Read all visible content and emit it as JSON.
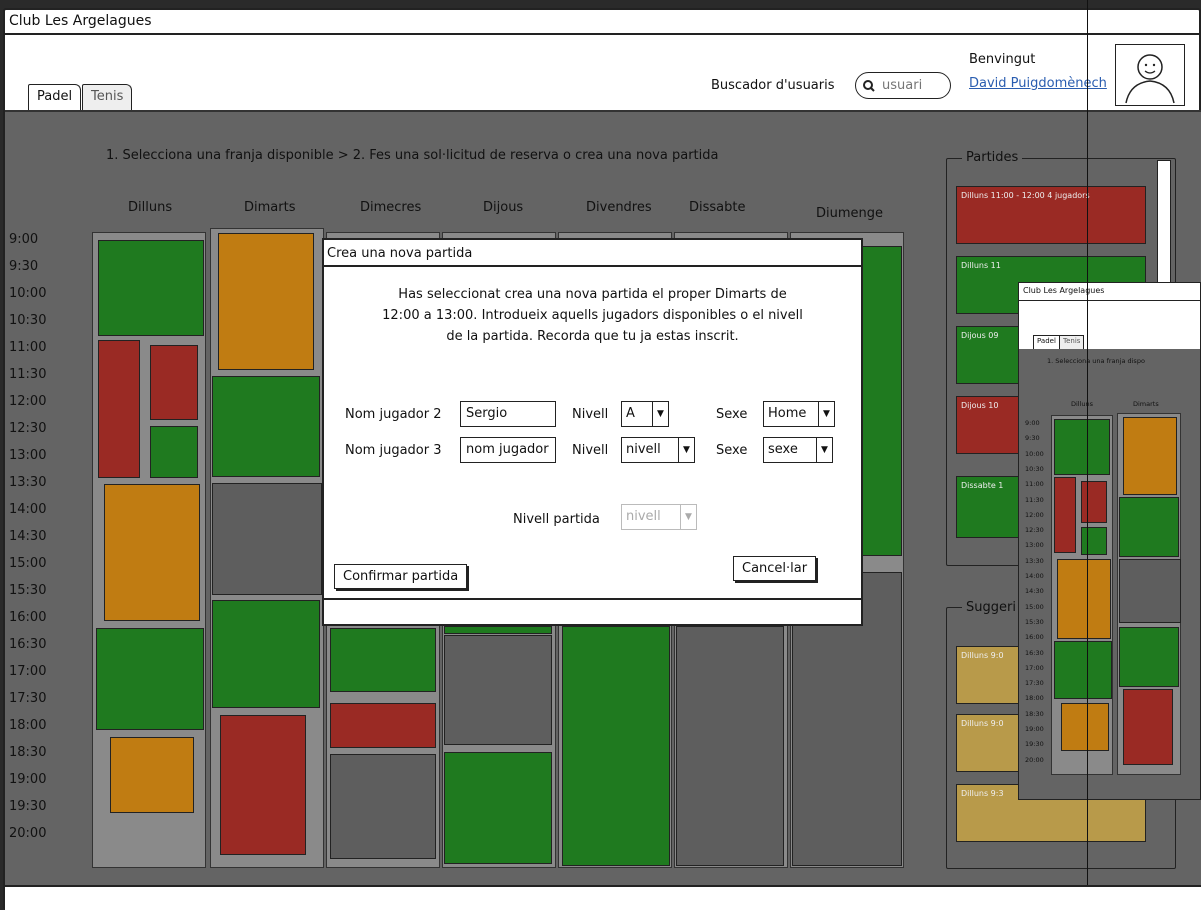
{
  "app": {
    "title": "Club Les Argelagues"
  },
  "tabs": [
    {
      "label": "Padel",
      "active": true
    },
    {
      "label": "Tenis",
      "active": false
    }
  ],
  "search": {
    "label": "Buscador d'usuaris",
    "placeholder": "usuari"
  },
  "user": {
    "welcome": "Benvingut",
    "name": "David Puigdomènech"
  },
  "steps": "1. Selecciona una franja disponible > 2. Fes una sol·licitud de reserva o crea una nova partida",
  "days": [
    "Dilluns",
    "Dimarts",
    "Dimecres",
    "Dijous",
    "Divendres",
    "Dissabte",
    "Diumenge"
  ],
  "times": [
    "9:00",
    "9:30",
    "10:00",
    "10:30",
    "11:00",
    "11:30",
    "12:00",
    "12:30",
    "13:00",
    "13:30",
    "14:00",
    "14:30",
    "15:00",
    "15:30",
    "16:00",
    "16:30",
    "17:00",
    "17:30",
    "18:00",
    "18:30",
    "19:00",
    "19:30",
    "20:00"
  ],
  "colors": {
    "available": "#1f7a1f",
    "partial": "#c07c12",
    "full": "#9a2a24",
    "closed": "#5e5e5e",
    "suggestion": "#b89a4a"
  },
  "partides": {
    "legend": "Partides",
    "items": [
      {
        "text": "Dilluns 11:00 - 12:00 4 jugadors",
        "status": "full"
      },
      {
        "text": "Dilluns 11",
        "status": "available"
      },
      {
        "text": "Dijous 09",
        "status": "available"
      },
      {
        "text": "Dijous 10",
        "status": "full"
      },
      {
        "text": "Dissabte 1",
        "status": "available"
      }
    ]
  },
  "suggeriments": {
    "legend": "Suggeri",
    "items": [
      {
        "text": "Dilluns 9:0"
      },
      {
        "text": "Dilluns 9:0"
      },
      {
        "text": "Dilluns 9:3"
      }
    ]
  },
  "dialog": {
    "title": "Crea una nova partida",
    "message": "Has seleccionat crea una nova partida el proper Dimarts de 12:00 a 13:00. Introdueix aquells jugadors disponibles o el nivell de la partida. Recorda que tu ja estas inscrit.",
    "row1": {
      "name_label": "Nom jugador 2",
      "name_value": "Sergio",
      "level_label": "Nivell",
      "level_value": "A",
      "sex_label": "Sexe",
      "sex_value": "Home"
    },
    "row2": {
      "name_label": "Nom jugador 3",
      "name_value": "nom jugador",
      "level_label": "Nivell",
      "level_value": "nivell",
      "sex_label": "Sexe",
      "sex_value": "sexe"
    },
    "match_level_label": "Nivell partida",
    "match_level_value": "nivell",
    "confirm": "Confirmar partida",
    "cancel": "Cancel·lar"
  },
  "thumbnail": {
    "title": "Club Les Argelagues",
    "tabs": [
      "Padel",
      "Tenis"
    ],
    "steps": "1. Selecciona una franja dispo",
    "days": [
      "Dilluns",
      "Dimarts"
    ],
    "times": [
      "9:00",
      "9:30",
      "10:00",
      "10:30",
      "11:00",
      "11:30",
      "12:00",
      "12:30",
      "13:00",
      "13:30",
      "14:00",
      "14:30",
      "15:00",
      "15:30",
      "16:00",
      "16:30",
      "17:00",
      "17:30",
      "18:00",
      "18:30",
      "19:00",
      "19:30",
      "20:00"
    ]
  }
}
